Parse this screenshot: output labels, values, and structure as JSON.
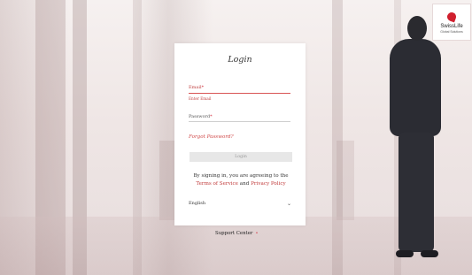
{
  "brand": {
    "logo_title": "SwissLife",
    "logo_subtitle": "Global Solutions",
    "accent_color": "#d01f2e"
  },
  "login": {
    "title": "Login",
    "email_label": "Email",
    "email_error": "Enter Email",
    "password_label": "Password",
    "required_mark": "*",
    "forgot_link": "Forgot Password?",
    "login_button": "Login",
    "agree_text": "By signing in, you are agreeing to the",
    "terms_link": "Terms of Service",
    "and_text": "and",
    "privacy_link": "Privacy Policy",
    "language_value": "English"
  },
  "footer": {
    "support_label": "Support Center"
  },
  "icons": {
    "language_chevron": "chevron-down-icon",
    "support_dot": "dot-icon"
  }
}
